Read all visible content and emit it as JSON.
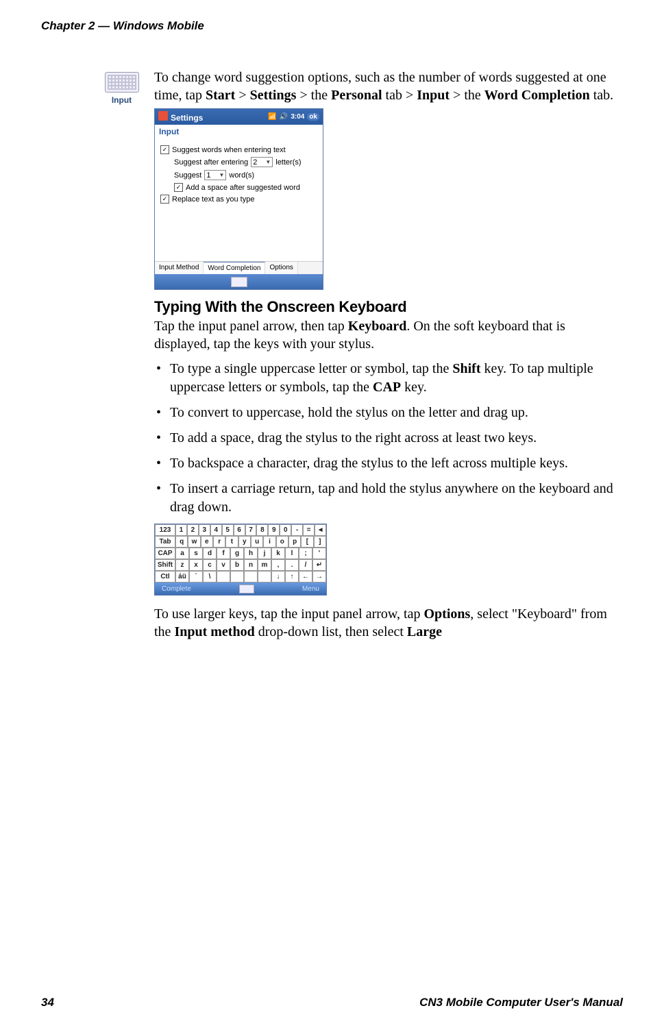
{
  "header": "Chapter 2 — Windows Mobile",
  "footer_page": "34",
  "footer_title": "CN3 Mobile Computer User's Manual",
  "icon_label": "Input",
  "para1_a": "To change word suggestion options, such as the number of words suggested at one time, tap ",
  "b_start": "Start",
  "gt": " > ",
  "b_settings": "Settings",
  "txt_the1": " > the ",
  "b_personal": "Personal",
  "txt_tab1": " tab > ",
  "b_input": "Input",
  "txt_the2": " > the ",
  "b_wordcomp": "Word Completion",
  "txt_tab2": " tab.",
  "wm": {
    "toolbar_title": "Settings",
    "time": "3:04",
    "ok": "ok",
    "subtitle": "Input",
    "row1": "Suggest words when entering text",
    "row2a": "Suggest after entering",
    "row2_dd": "2",
    "row2b": "letter(s)",
    "row3a": "Suggest",
    "row3_dd": "1",
    "row3b": "word(s)",
    "row4": "Add a space after suggested word",
    "row5": "Replace text as you type",
    "tab1": "Input Method",
    "tab2": "Word Completion",
    "tab3": "Options"
  },
  "section_heading": "Typing With the Onscreen Keyboard",
  "para2_a": "Tap the input panel arrow, then tap ",
  "b_keyboard": "Keyboard",
  "para2_b": ". On the soft keyboard that is displayed, tap the keys with your stylus.",
  "bullets": {
    "b1a": "To type a single uppercase letter or symbol, tap the ",
    "b1_shift": "Shift",
    "b1b": " key. To tap multiple uppercase letters or symbols, tap the ",
    "b1_cap": "CAP",
    "b1c": " key.",
    "b2": "To convert to uppercase, hold the stylus on the letter and drag up.",
    "b3": "To add a space, drag the stylus to the right across at least two keys.",
    "b4": "To backspace a character, drag the stylus to the left across multiple keys.",
    "b5": "To insert a carriage return, tap and hold the stylus anywhere on the keyboard and drag down."
  },
  "kb": {
    "row1": [
      "123",
      "1",
      "2",
      "3",
      "4",
      "5",
      "6",
      "7",
      "8",
      "9",
      "0",
      "-",
      "=",
      "◄"
    ],
    "row2": [
      "Tab",
      "q",
      "w",
      "e",
      "r",
      "t",
      "y",
      "u",
      "i",
      "o",
      "p",
      "[",
      "]"
    ],
    "row3": [
      "CAP",
      "a",
      "s",
      "d",
      "f",
      "g",
      "h",
      "j",
      "k",
      "l",
      ";",
      "'"
    ],
    "row4": [
      "Shift",
      "z",
      "x",
      "c",
      "v",
      "b",
      "n",
      "m",
      ",",
      ".",
      "/",
      "↵"
    ],
    "row5": [
      "Ctl",
      "áü",
      "`",
      "\\",
      "",
      "",
      "",
      "",
      "↓",
      "↑",
      "←",
      "→"
    ],
    "bar_left": "Complete",
    "bar_right": "Menu"
  },
  "para3_a": "To use larger keys, tap the input panel arrow, tap ",
  "b_options": "Options",
  "para3_b": ", select \"Keyboard\" from the ",
  "b_inputmethod": "Input method",
  "para3_c": " drop-down list, then select ",
  "b_large": "Large"
}
